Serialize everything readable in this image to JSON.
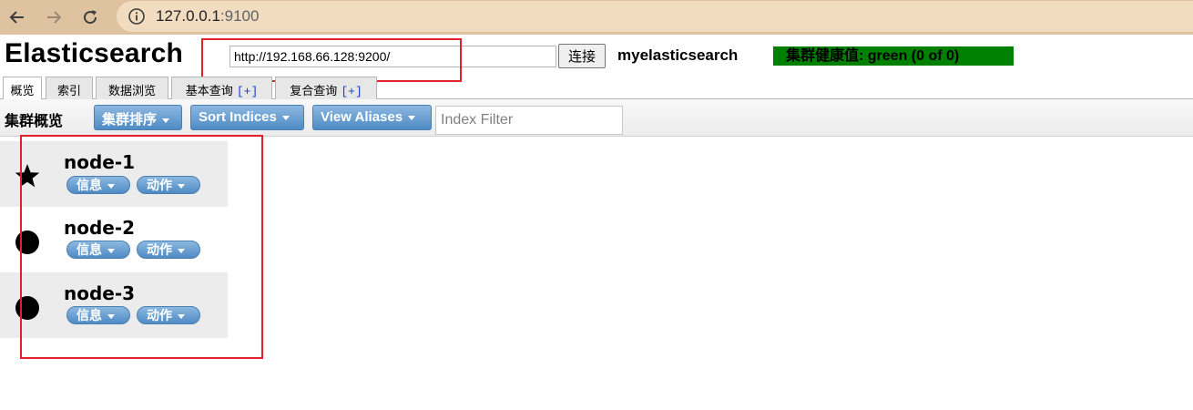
{
  "browser": {
    "url_host": "127.0.0.1",
    "url_port": ":9100"
  },
  "app": {
    "title": "Elasticsearch",
    "connect_url": "http://192.168.66.128:9200/",
    "connect_label": "连接",
    "cluster_name": "myelasticsearch",
    "health_text": "集群健康值: green (0 of 0)",
    "health_color": "#008000"
  },
  "tabs": [
    {
      "label": "概览",
      "plus": "",
      "active": true
    },
    {
      "label": "索引",
      "plus": "",
      "active": false
    },
    {
      "label": "数据浏览",
      "plus": "",
      "active": false
    },
    {
      "label": "基本查询 ",
      "plus": "[+]",
      "active": false
    },
    {
      "label": "复合查询 ",
      "plus": "[+]",
      "active": false
    }
  ],
  "toolbar": {
    "title": "集群概览",
    "sort_cluster_label": "集群排序",
    "sort_indices_label": "Sort Indices",
    "view_aliases_label": "View Aliases",
    "index_filter_placeholder": "Index Filter"
  },
  "nodes": [
    {
      "name": "node-1",
      "icon": "star-icon",
      "master": true,
      "info_label": "信息",
      "action_label": "动作"
    },
    {
      "name": "node-2",
      "icon": "circle-icon",
      "master": false,
      "info_label": "信息",
      "action_label": "动作"
    },
    {
      "name": "node-3",
      "icon": "circle-icon",
      "master": false,
      "info_label": "信息",
      "action_label": "动作"
    }
  ],
  "accent_color": "#4e8bc4",
  "annotation_color": "#e0202a"
}
